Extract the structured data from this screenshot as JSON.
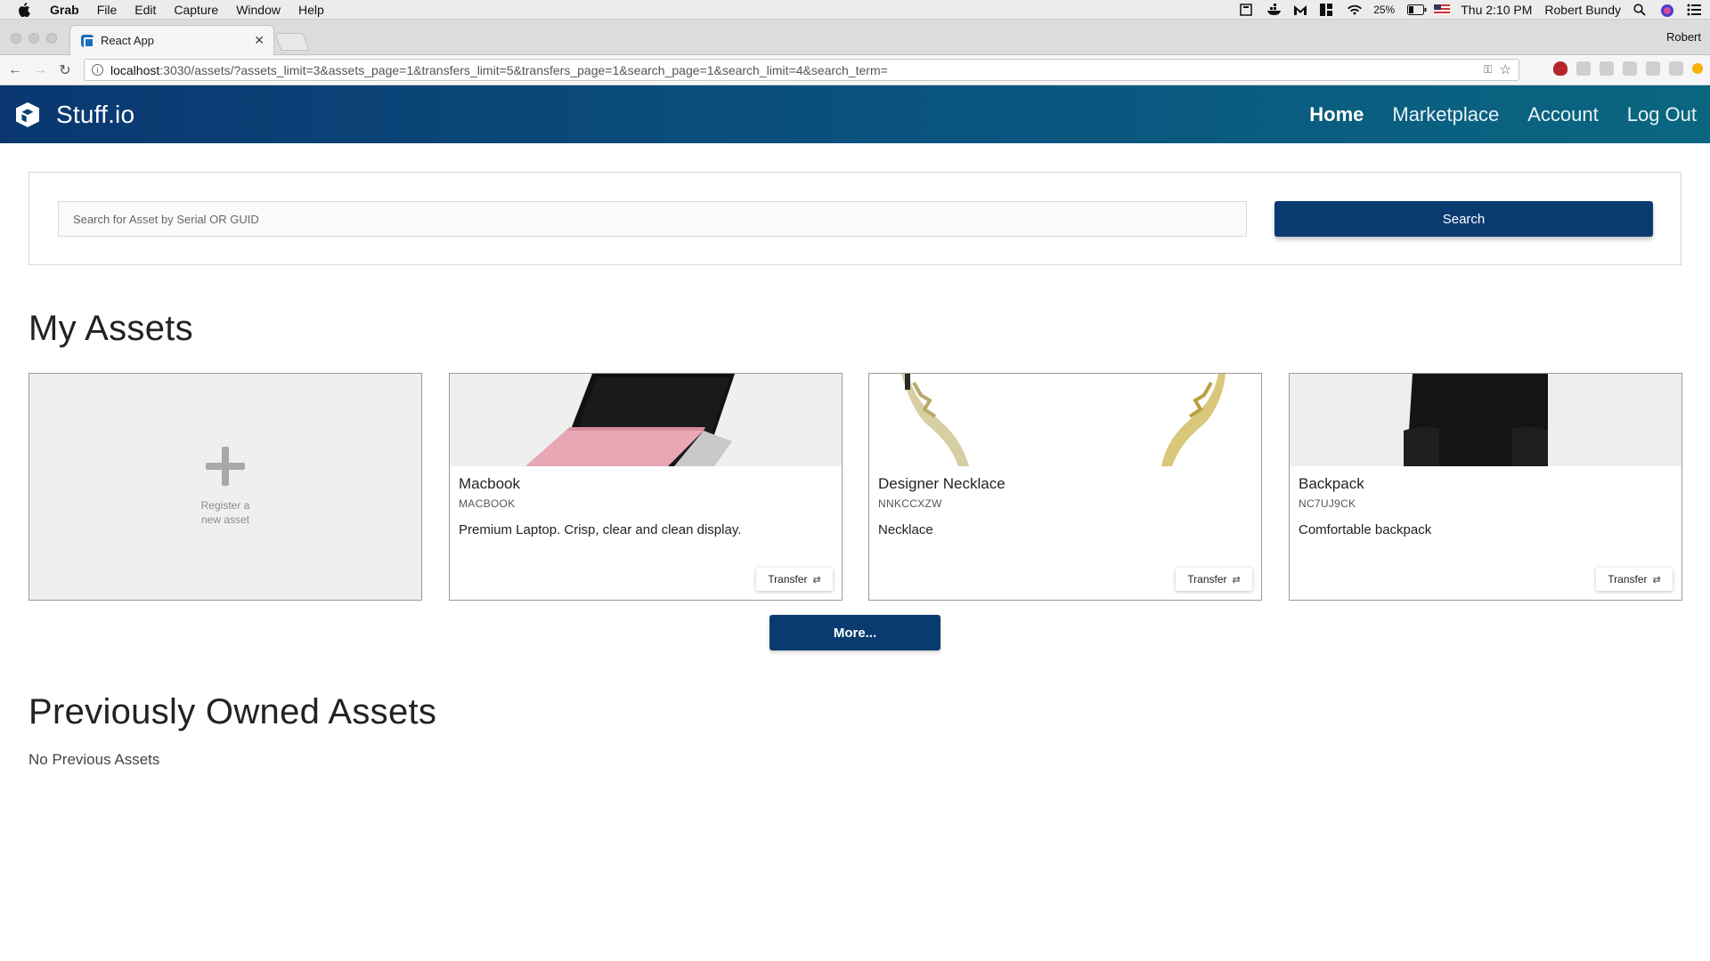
{
  "menubar": {
    "app_name": "Grab",
    "items": [
      "File",
      "Edit",
      "Capture",
      "Window",
      "Help"
    ],
    "battery": "25%",
    "clock": "Thu 2:10 PM",
    "user": "Robert Bundy"
  },
  "browser": {
    "tab_title": "React App",
    "profile": "Robert",
    "url_host": "localhost",
    "url_path": ":3030/assets/?assets_limit=3&assets_page=1&transfers_limit=5&transfers_page=1&search_page=1&search_limit=4&search_term="
  },
  "header": {
    "brand": "Stuff.io",
    "nav": [
      "Home",
      "Marketplace",
      "Account",
      "Log Out"
    ]
  },
  "search": {
    "placeholder": "Search for Asset by Serial OR GUID",
    "value": "",
    "button": "Search"
  },
  "my_assets": {
    "title": "My Assets",
    "register_label": "Register a new asset",
    "transfer_label": "Transfer",
    "more_label": "More...",
    "items": [
      {
        "name": "Macbook",
        "serial": "MACBOOK",
        "description": "Premium Laptop. Crisp, clear and clean display."
      },
      {
        "name": "Designer Necklace",
        "serial": "NNKCCXZW",
        "description": "Necklace"
      },
      {
        "name": "Backpack",
        "serial": "NC7UJ9CK",
        "description": "Comfortable backpack"
      }
    ]
  },
  "previous": {
    "title": "Previously Owned Assets",
    "empty": "No Previous Assets"
  },
  "colors": {
    "brand_dark": "#0a3770",
    "brand_teal": "#0a6680",
    "button": "#0a3b70"
  }
}
